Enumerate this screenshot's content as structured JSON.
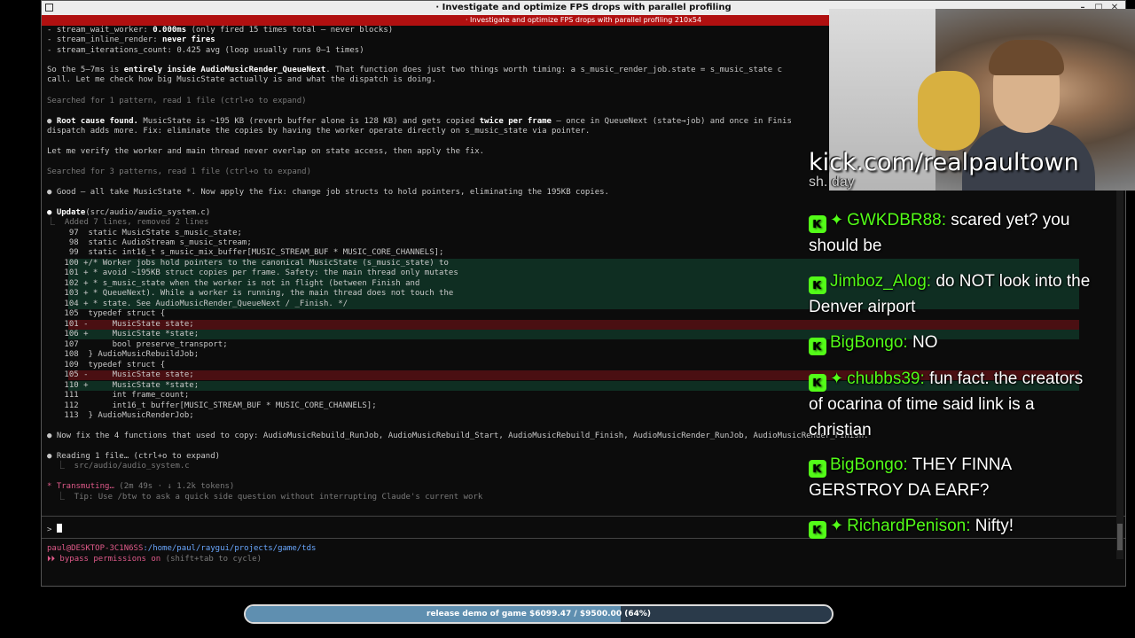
{
  "window": {
    "title": "· Investigate and optimize FPS drops with parallel profiling",
    "tab": "· Investigate and optimize FPS drops with parallel profiling 210x54"
  },
  "terminal": {
    "l1a": "- stream_wait_worker: ",
    "l1b": "0.000ms",
    "l1c": " (only fired 15 times total — never blocks)",
    "l2a": "- stream_inline_render: ",
    "l2b": "never fires",
    "l3a": "- stream_iterations_count: ",
    "l3b": "0.425 avg (loop usually runs 0–1 times)",
    "p1a": "So the 5–7ms is ",
    "p1b": "entirely inside AudioMusicRender_QueueNext",
    "p1c": ". That function does just two things worth timing: a s_music_render_job.state = s_music_state c",
    "p1d": "call. Let me check how big MusicState actually is and what the dispatch is doing.",
    "search1": "Searched for 1 pattern, read 1 file (ctrl+o to expand)",
    "rc_a": "● ",
    "rc_b": "Root cause found.",
    "rc_c": " MusicState is ~195 KB (reverb buffer alone is 128 KB) and gets copied ",
    "rc_d": "twice per frame",
    "rc_e": " — once in QueueNext (state→job) and once in Finis",
    "rc2": "dispatch adds more. Fix: eliminate the copies by having the worker operate directly on s_music_state via pointer.",
    "verify": "Let me verify the worker and main thread never overlap on state access, then apply the fix.",
    "search2": "Searched for 3 patterns, read 1 file (ctrl+o to expand)",
    "good": "● Good — all take MusicState *. Now apply the fix: change job structs to hold pointers, eliminating the 195KB copies.",
    "upd_a": "● Update",
    "upd_b": "(src/audio/audio_system.c)",
    "added": "⎿  Added 7 lines, removed 2 lines",
    "c97": "  97  static MusicState s_music_state;",
    "c98": "  98  static AudioStream s_music_stream;",
    "c99": "  99  static int16_t s_music_mix_buffer[MUSIC_STREAM_BUF * MUSIC_CORE_CHANNELS];",
    "c100": " 100 +/* Worker jobs hold pointers to the canonical MusicState (s_music_state) to",
    "c101": " 101 + * avoid ~195KB struct copies per frame. Safety: the main thread only mutates",
    "c102": " 102 + * s_music_state when the worker is not in flight (between Finish and",
    "c103": " 103 + * QueueNext). While a worker is running, the main thread does not touch the",
    "c104": " 104 + * state. See AudioMusicRender_QueueNext / _Finish. */",
    "c105": " 105  typedef struct {",
    "c101d": " 101 -     MusicState state;",
    "c106": " 106 +     MusicState *state;",
    "c107": " 107       bool preserve_transport;",
    "c108": " 108  } AudioMusicRebuildJob;",
    "c109": " 109  typedef struct {",
    "c105d": " 105 -     MusicState state;",
    "c110": " 110 +     MusicState *state;",
    "c111": " 111       int frame_count;",
    "c112": " 112       int16_t buffer[MUSIC_STREAM_BUF * MUSIC_CORE_CHANNELS];",
    "c113": " 113  } AudioMusicRenderJob;",
    "fix": "● Now fix the 4 functions that used to copy: AudioMusicRebuild_RunJob, AudioMusicRebuild_Start, AudioMusicRebuild_Finish, AudioMusicRender_RunJob, AudioMusicRender_Finish.",
    "reading": "● Reading 1 file… (ctrl+o to expand)",
    "readpath": "  ⎿  src/audio/audio_system.c",
    "trans_a": "* Transmuting…",
    "trans_b": " (2m 49s · ↓ 1.2k tokens)",
    "tip": "  ⎿  Tip: Use /btw to ask a quick side question without interrupting Claude's current work",
    "prompt": "> ",
    "user": "paul@DESKTOP-3C1N6SS",
    "path": ":/home/paul/raygui/projects/game/tds",
    "bypass_a": "⏵⏵",
    "bypass_b": " bypass permissions on",
    "bypass_c": " (shift+tab to cycle)"
  },
  "overlay": {
    "kick_url": "kick.com/realpaultown",
    "partial": "sh. day",
    "messages": [
      {
        "user": "GWKDBR88:",
        "text": "scared yet? you should be",
        "badge": "K",
        "star": true
      },
      {
        "user": "Jimboz_Alog:",
        "text": "do NOT look into the Denver airport",
        "badge": "K",
        "star": false
      },
      {
        "user": "BigBongo:",
        "text": "NO",
        "badge": "K",
        "star": false
      },
      {
        "user": "chubbs39:",
        "text": "fun fact. the creators of ocarina of time said link is a christian",
        "badge": "K",
        "star": true
      },
      {
        "user": "BigBongo:",
        "text": "THEY FINNA GERSTROY DA EARF?",
        "badge": "K",
        "star": false
      },
      {
        "user": "RichardPenison:",
        "text": "Nifty!",
        "badge": "K",
        "star": true
      }
    ]
  },
  "goal": {
    "label": "release demo of game $6099.47 / $9500.00 (64%)",
    "progress": 0.64
  },
  "colors": {
    "accent": "#53fc18",
    "tab_red": "#b01010"
  }
}
